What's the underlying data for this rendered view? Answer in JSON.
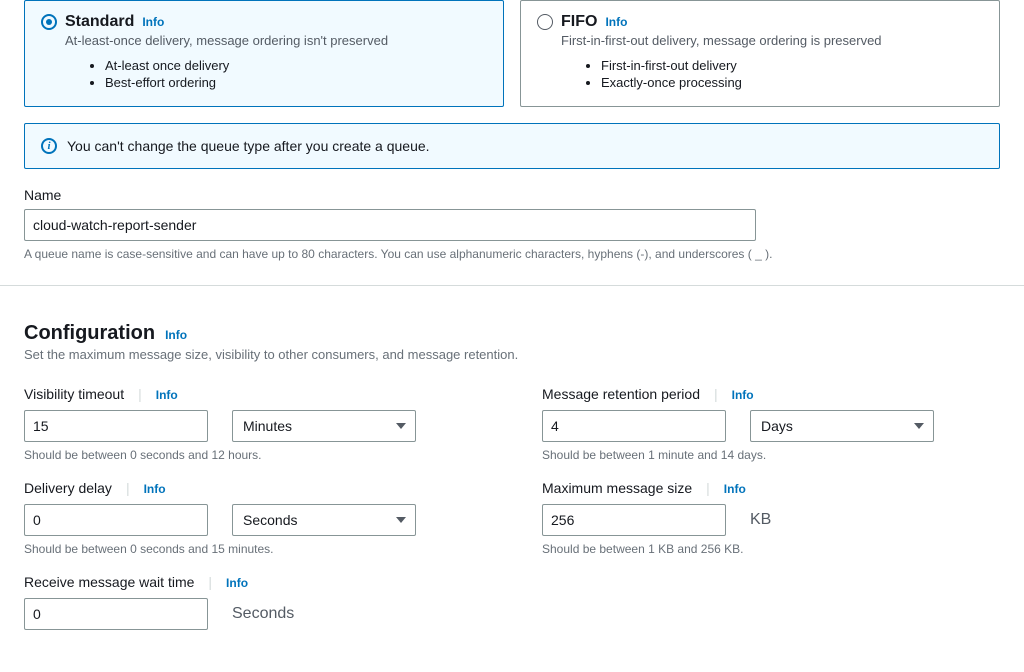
{
  "queueTypes": {
    "standard": {
      "title": "Standard",
      "info": "Info",
      "desc": "At-least-once delivery, message ordering isn't preserved",
      "bullet1": "At-least once delivery",
      "bullet2": "Best-effort ordering"
    },
    "fifo": {
      "title": "FIFO",
      "info": "Info",
      "desc": "First-in-first-out delivery, message ordering is preserved",
      "bullet1": "First-in-first-out delivery",
      "bullet2": "Exactly-once processing"
    }
  },
  "alert": {
    "text": "You can't change the queue type after you create a queue."
  },
  "nameField": {
    "label": "Name",
    "value": "cloud-watch-report-sender",
    "helper": "A queue name is case-sensitive and can have up to 80 characters. You can use alphanumeric characters, hyphens (-), and underscores ( _ )."
  },
  "config": {
    "title": "Configuration",
    "info": "Info",
    "desc": "Set the maximum message size, visibility to other consumers, and message retention.",
    "visibility": {
      "label": "Visibility timeout",
      "info": "Info",
      "value": "15",
      "unit": "Minutes",
      "helper": "Should be between 0 seconds and 12 hours."
    },
    "retention": {
      "label": "Message retention period",
      "info": "Info",
      "value": "4",
      "unit": "Days",
      "helper": "Should be between 1 minute and 14 days."
    },
    "delay": {
      "label": "Delivery delay",
      "info": "Info",
      "value": "0",
      "unit": "Seconds",
      "helper": "Should be between 0 seconds and 15 minutes."
    },
    "maxsize": {
      "label": "Maximum message size",
      "info": "Info",
      "value": "256",
      "unit": "KB",
      "helper": "Should be between 1 KB and 256 KB."
    },
    "waittime": {
      "label": "Receive message wait time",
      "info": "Info",
      "value": "0",
      "unit": "Seconds"
    }
  }
}
